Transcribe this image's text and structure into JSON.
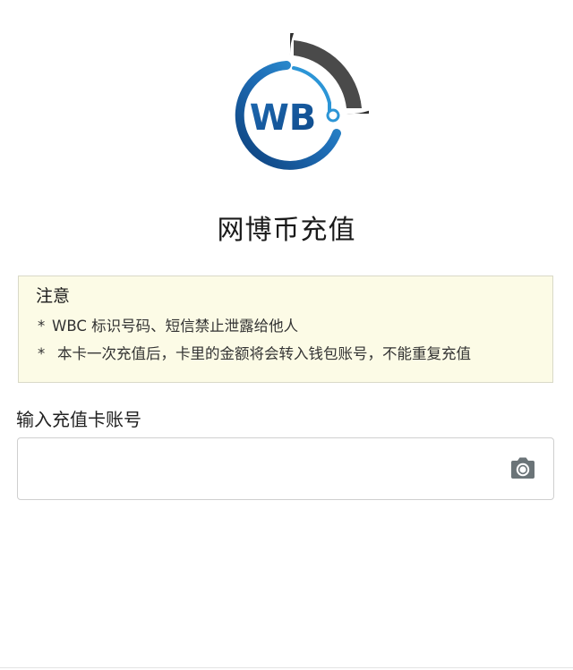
{
  "logo": {
    "text": "WB",
    "ring_color": "#2e2e2e",
    "accent_color": "#1f6fb8",
    "icon": "wb-coin-logo-icon"
  },
  "page_title": "网博币充值",
  "notice": {
    "title": "注意",
    "items": [
      {
        "marker": "*",
        "text": "WBC 标识号码、短信禁止泄露给他人"
      },
      {
        "marker": "*",
        "text": "本卡一次充值后，卡里的金额将会转入钱包账号，不能重复充值"
      }
    ],
    "background_color": "#fcfbe6"
  },
  "card_input": {
    "label": "输入充值卡账号",
    "value": "",
    "placeholder": "",
    "camera_icon": "camera-icon",
    "icon_color": "#6b7478"
  }
}
